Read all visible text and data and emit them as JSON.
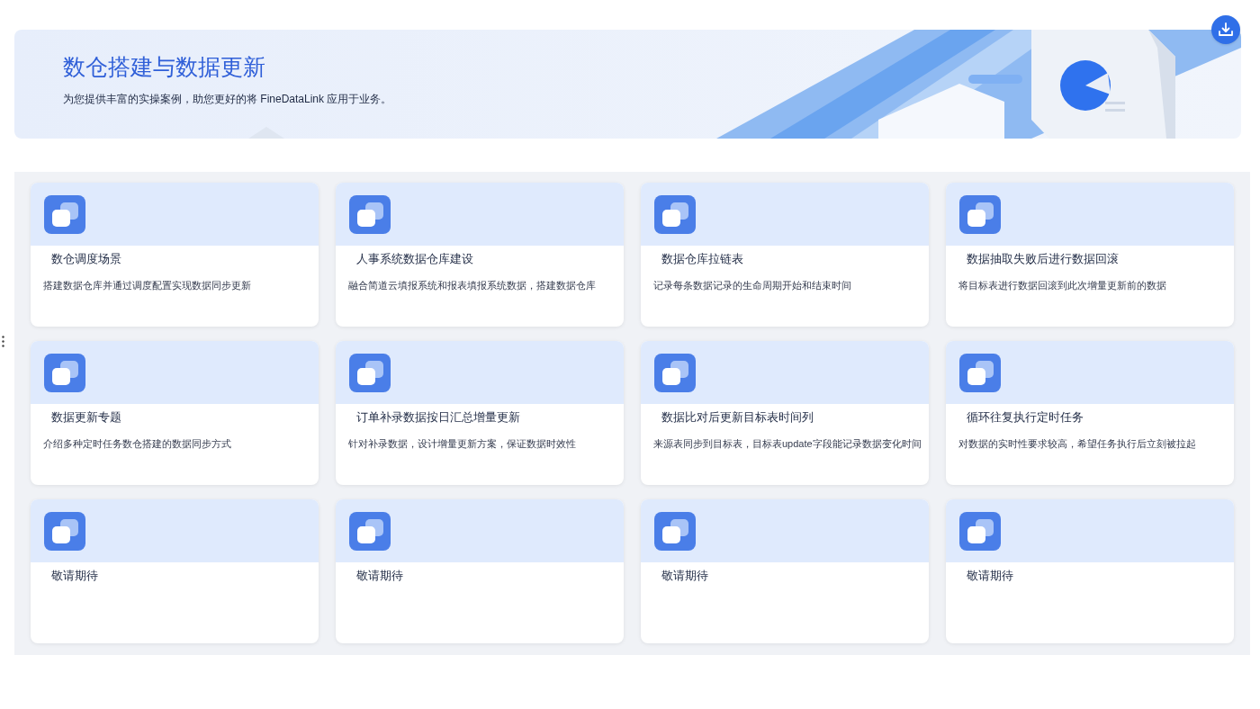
{
  "header": {
    "title": "数仓搭建与数据更新",
    "subtitle": "为您提供丰富的实操案例，助您更好的将 FineDataLink 应用于业务。"
  },
  "cards": [
    {
      "title": "数仓调度场景",
      "description": "搭建数据仓库并通过调度配置实现数据同步更新"
    },
    {
      "title": "人事系统数据仓库建设",
      "description": "融合简道云填报系统和报表填报系统数据，搭建数据仓库"
    },
    {
      "title": "数据仓库拉链表",
      "description": "记录每条数据记录的生命周期开始和结束时间"
    },
    {
      "title": "数据抽取失败后进行数据回滚",
      "description": "将目标表进行数据回滚到此次增量更新前的数据"
    },
    {
      "title": "数据更新专题",
      "description": "介绍多种定时任务数仓搭建的数据同步方式"
    },
    {
      "title": "订单补录数据按日汇总增量更新",
      "description": "针对补录数据，设计增量更新方案，保证数据时效性"
    },
    {
      "title": "数据比对后更新目标表时间列",
      "description": "来源表同步到目标表，目标表update字段能记录数据变化时间"
    },
    {
      "title": "循环往复执行定时任务",
      "description": "对数据的实时性要求较高，希望任务执行后立刻被拉起"
    },
    {
      "title": "敬请期待"
    },
    {
      "title": "敬请期待"
    },
    {
      "title": "敬请期待"
    },
    {
      "title": "敬请期待"
    }
  ]
}
